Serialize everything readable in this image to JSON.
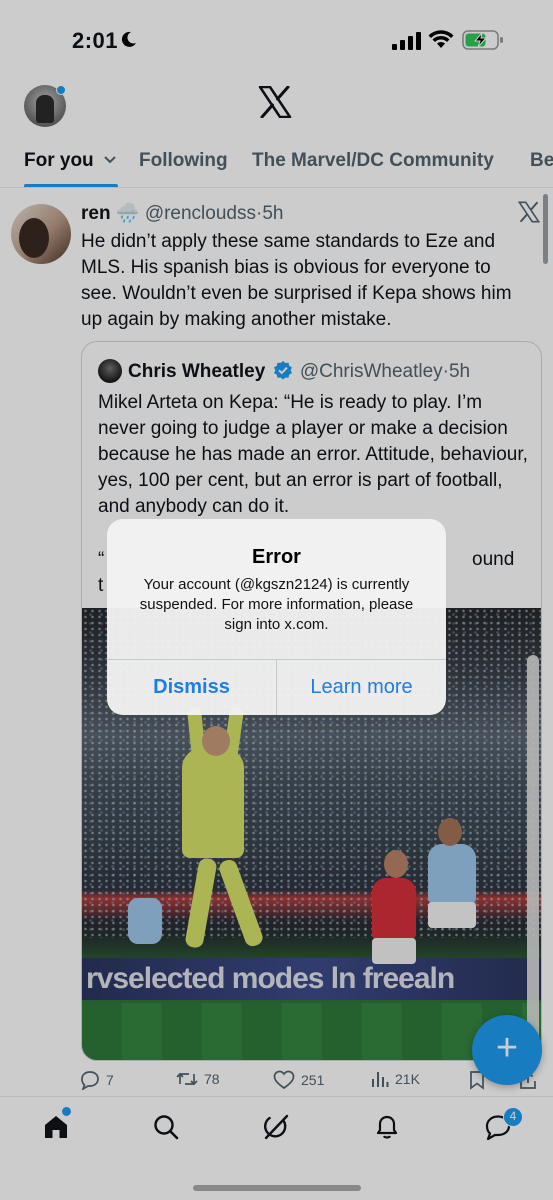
{
  "status_bar": {
    "time": "2:01",
    "icons": [
      "moon-icon",
      "signal-icon",
      "wifi-icon",
      "battery-charging-icon"
    ]
  },
  "header": {
    "logo": "X",
    "tabs": [
      {
        "label": "For you",
        "active": true
      },
      {
        "label": "Following"
      },
      {
        "label": "The Marvel/DC Community"
      },
      {
        "label": "Be"
      }
    ]
  },
  "tweet": {
    "name": "ren",
    "emoji": "🌧️",
    "handle": "@rencloudss",
    "separator": "·",
    "time": "5h",
    "text": "He didn’t apply these same standards to Eze and MLS. His spanish bias is obvious for everyone to see. Wouldn’t even be surprised if Kepa shows him up again by making another mistake.",
    "quote": {
      "name": "Chris Wheatley",
      "verified": true,
      "handle": "@ChrisWheatley",
      "separator": "·",
      "time": "5h",
      "text": "Mikel Arteta on Kepa: “He is ready to play. I’m never going to judge a player or make a decision because he has made an error. Attitude, behaviour, yes, 100 per cent, but an error is part of football, and anybody can do it.",
      "text_fragment_left": "“",
      "text_fragment_right": "ound",
      "text_fragment_line2": "t",
      "photo_board_text": "rvselected modes ln freealn"
    },
    "actions": {
      "replies": "7",
      "reposts": "78",
      "likes": "251",
      "views": "21K"
    }
  },
  "alert": {
    "title": "Error",
    "message": "Your account (@kgszn2124) is currently suspended. For more information, please sign into x.com.",
    "dismiss_label": "Dismiss",
    "learn_more_label": "Learn more"
  },
  "bottom_nav": {
    "items": [
      "home-icon",
      "search-icon",
      "grok-icon",
      "notifications-icon",
      "messages-icon"
    ],
    "messages_badge": "4"
  },
  "colors": {
    "accent": "#1d9bf0",
    "text_muted": "#536471"
  }
}
